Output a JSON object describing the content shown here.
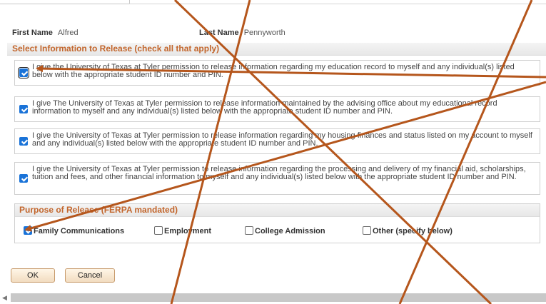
{
  "person": {
    "first_name_label": "First Name",
    "first_name_value": "Alfred",
    "last_name_label": "Last Name",
    "last_name_value": "Pennyworth"
  },
  "release_section": {
    "title": "Select Information to Release (check all that apply)",
    "options": [
      {
        "text": "I give the University of Texas at Tyler permission to release information regarding my education record to myself and any individual(s) listed below with the appropriate student ID number and PIN.",
        "checked": true
      },
      {
        "text": "I give The University of Texas at Tyler permission to release information maintained by the advising office about my educational record information to myself and any individual(s) listed below with the appropriate student ID number and PIN.",
        "checked": true
      },
      {
        "text": "I give the University of Texas at Tyler permission to release information regarding my housing finances and status listed on my account to myself and any individual(s) listed below with the appropriate student ID number and PIN.",
        "checked": true
      },
      {
        "text": "I give the University of Texas at Tyler permission to release information regarding the processing and delivery of my financial aid, scholarships, tuition and fees, and other financial information to myself and any individual(s) listed below with the appropriate student ID number and PIN.",
        "checked": true
      }
    ]
  },
  "purpose_section": {
    "title": "Purpose of Release (FERPA mandated)",
    "options": [
      {
        "label": "Family Communications",
        "checked": true
      },
      {
        "label": "Employment",
        "checked": false
      },
      {
        "label": "College Admission",
        "checked": false
      },
      {
        "label": "Other (specify below)",
        "checked": false
      }
    ]
  },
  "buttons": {
    "ok": "OK",
    "cancel": "Cancel"
  },
  "colors": {
    "section_title": "#c2652b",
    "checkbox": "#1a73d8",
    "annotation_arrow": "#b5561c"
  }
}
